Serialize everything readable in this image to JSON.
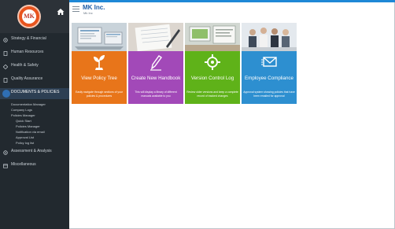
{
  "header": {
    "company_name": "MK Inc.",
    "company_sub": "Mk Inc"
  },
  "logo": {
    "text": "MK"
  },
  "sidebar": {
    "items": [
      {
        "label": "Strategy & Financial",
        "icon": "gear-icon"
      },
      {
        "label": "Human Resources",
        "icon": "document-icon"
      },
      {
        "label": "Health & Safety",
        "icon": "diamond-icon"
      },
      {
        "label": "Quality Assurance",
        "icon": "document-icon"
      },
      {
        "label": "DOCUMENTS & POLICIES",
        "icon": "circle-icon",
        "active": true
      }
    ],
    "sub_items": [
      {
        "label": "Documentation Manager"
      },
      {
        "label": "Company Logs"
      },
      {
        "label": "Policies Manager"
      }
    ],
    "sub_sub_items": [
      {
        "label": "Quick Start"
      },
      {
        "label": "Policies Manager"
      },
      {
        "label": "Notification via email"
      },
      {
        "label": "Approval List"
      },
      {
        "label": "Policy log list"
      }
    ],
    "bottom_items": [
      {
        "label": "Assessment & Analysis",
        "icon": "gear-icon"
      },
      {
        "label": "Miscellaneous",
        "icon": "window-icon"
      }
    ]
  },
  "tiles": [
    {
      "title": "View Policy Tree",
      "description": "Easily navigate through sections of your policies & procedures",
      "icon": "plant-icon",
      "color": "#e8751a"
    },
    {
      "title": "Create New Handbook",
      "description": "This will display a library of different manuals available to you",
      "icon": "pencil-icon",
      "color": "#a249b8"
    },
    {
      "title": "Version Control Log",
      "description": "Review older versions and keep a complete record of tracked changes",
      "icon": "cog-sync-icon",
      "color": "#5fb219"
    },
    {
      "title": "Employee Compliance",
      "description": "Approval system showing policies that have been emailed for approval",
      "icon": "envelope-icon",
      "color": "#2d8fd0"
    }
  ],
  "colors": {
    "sidebar_bg": "#22292f",
    "accent_blue": "#1e88d6",
    "company_text": "#1f5fa8"
  }
}
